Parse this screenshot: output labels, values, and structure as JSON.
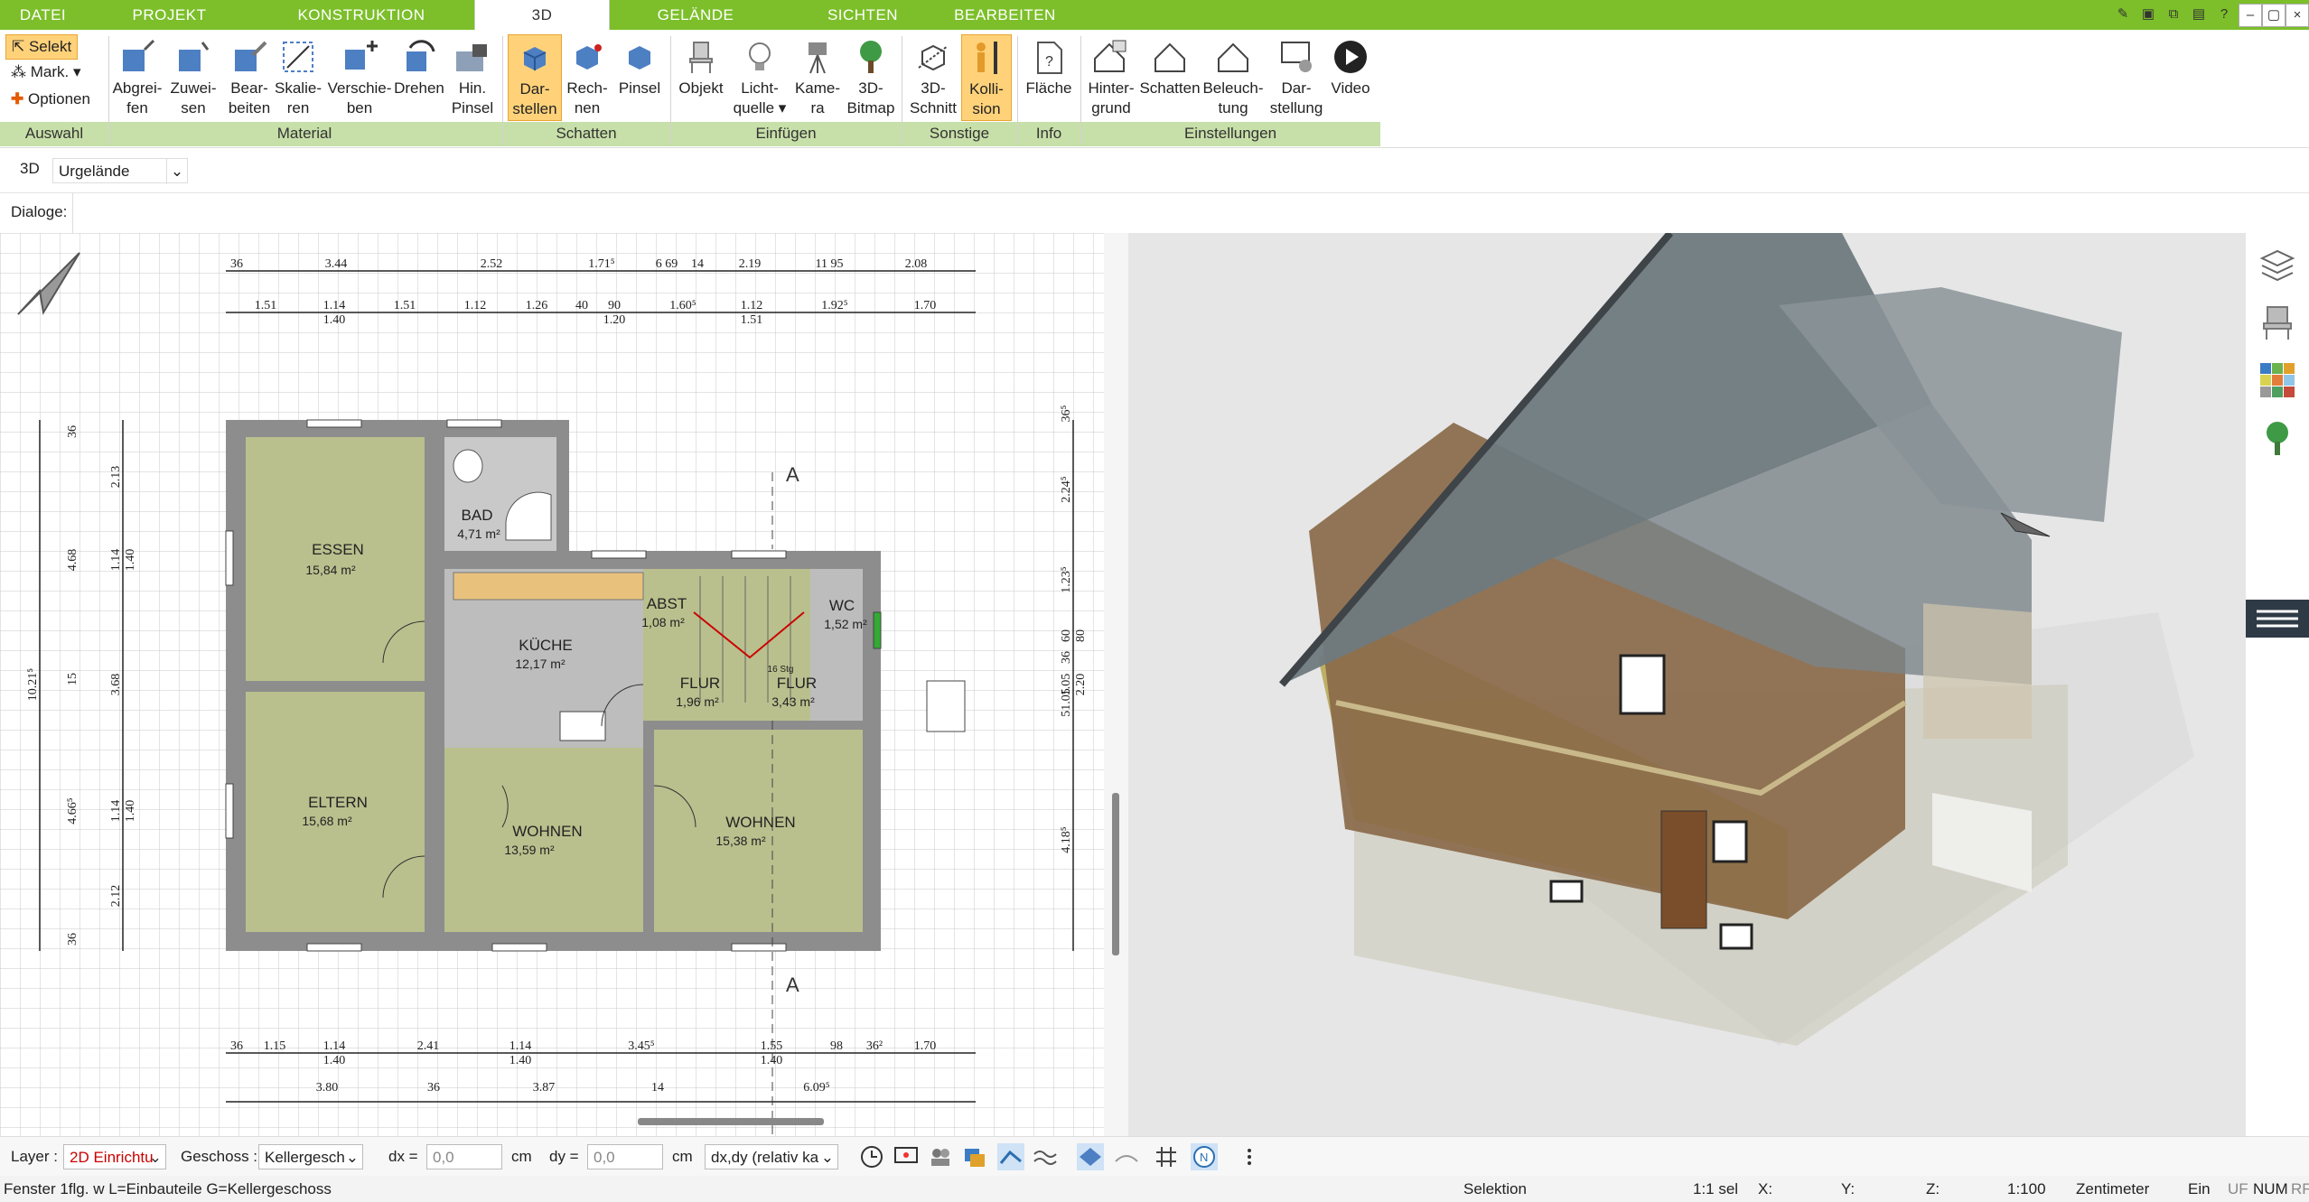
{
  "menu": {
    "tabs": [
      "DATEI",
      "PROJEKT",
      "KONSTRUKTION",
      "3D",
      "GELÄNDE",
      "SICHTEN",
      "BEARBEITEN"
    ],
    "active_tab": "3D"
  },
  "ribbon": {
    "auswahl": {
      "selekt": "Selekt",
      "mark": "Mark.",
      "optionen": "Optionen",
      "label": "Auswahl"
    },
    "material": {
      "label": "Material",
      "buttons": [
        [
          "Abgrei-",
          "fen"
        ],
        [
          "Zuwei-",
          "sen"
        ],
        [
          "Bear-",
          "beiten"
        ],
        [
          "Skalie-",
          "ren"
        ],
        [
          "Verschie-",
          "ben"
        ],
        [
          "Drehen",
          ""
        ],
        [
          "Hin.",
          "Pinsel"
        ]
      ]
    },
    "schatten": {
      "label": "Schatten",
      "buttons": [
        [
          "Dar-",
          "stellen"
        ],
        [
          "Rech-",
          "nen"
        ],
        [
          "Pinsel",
          ""
        ]
      ]
    },
    "einfuegen": {
      "label": "Einfügen",
      "buttons": [
        [
          "Objekt",
          ""
        ],
        [
          "Licht-",
          "quelle"
        ],
        [
          "Kame-",
          "ra"
        ],
        [
          "3D-",
          "Bitmap"
        ]
      ]
    },
    "sonstige": {
      "label": "Sonstige",
      "buttons": [
        [
          "3D-",
          "Schnitt"
        ],
        [
          "Kolli-",
          "sion"
        ]
      ]
    },
    "info": {
      "label": "Info",
      "buttons": [
        [
          "Fläche",
          ""
        ]
      ]
    },
    "einstellungen": {
      "label": "Einstellungen",
      "buttons": [
        [
          "Hinter-",
          "grund"
        ],
        [
          "Schatten",
          ""
        ],
        [
          "Beleuch-",
          "tung"
        ],
        [
          "Dar-",
          "stellung"
        ],
        [
          "Video",
          ""
        ]
      ]
    }
  },
  "toolbar2": {
    "mode": "3D",
    "select_value": "Urgelände"
  },
  "dialogs": {
    "label": "Dialoge:"
  },
  "plan": {
    "rooms": [
      {
        "name": "ESSEN",
        "area": "15,84 m²"
      },
      {
        "name": "BAD",
        "area": "4,71 m²"
      },
      {
        "name": "KÜCHE",
        "area": "12,17 m²"
      },
      {
        "name": "ABST",
        "area": "1,08 m²"
      },
      {
        "name": "WC",
        "area": "1,52 m²"
      },
      {
        "name": "FLUR",
        "area": "1,96 m²"
      },
      {
        "name": "FLUR",
        "area": "3,43 m²"
      },
      {
        "name": "ELTERN",
        "area": "15,68 m²"
      },
      {
        "name": "WOHNEN",
        "area": "13,59 m²"
      },
      {
        "name": "WOHNEN",
        "area": "15,38 m²"
      }
    ],
    "section_mark": "A",
    "dims_top1": [
      "36",
      "3.44",
      "2.52",
      "1.71⁵",
      "6 69",
      "14",
      "2.19",
      "11 95",
      "2.08"
    ],
    "dims_top2": [
      "1.51",
      "1.14",
      "1.40",
      "1.51",
      "1.12",
      "1.26",
      "40",
      "90",
      "1.20",
      "1.60⁵",
      "1.12",
      "1.51",
      "1.92⁵",
      "1.70"
    ],
    "dims_bottom1": [
      "36",
      "1.15",
      "1.14",
      "1.40",
      "2.41",
      "1.14",
      "1.40",
      "3.45⁵",
      "1.55",
      "1.40",
      "98",
      "36²",
      "1.70"
    ],
    "dims_bottom2": [
      "3.80",
      "36",
      "3.87",
      "14",
      "6.09⁵"
    ],
    "dims_left": [
      "36",
      "2.13",
      "4.68",
      "1.14",
      "1.40",
      "10.21⁵",
      "15",
      "3.68",
      "4.66⁵",
      "1.14",
      "1.40",
      "2.12",
      "36"
    ],
    "dims_right": [
      "36⁵",
      "2.24⁵",
      "1.23⁵",
      "60",
      "80",
      "51.05",
      "1.05",
      "36",
      "2.20",
      "4.18⁵"
    ],
    "stairs_label": "16 Stg"
  },
  "statusbar": {
    "layer_label": "Layer :",
    "layer_value": "2D Einrichtu",
    "geschoss_label": "Geschoss :",
    "geschoss_value": "Kellergesch",
    "dx_label": "dx =",
    "dx_value": "0,0",
    "dx_unit": "cm",
    "dy_label": "dy =",
    "dy_value": "0,0",
    "dy_unit": "cm",
    "mode_value": "dx,dy (relativ ka"
  },
  "infobar": {
    "text": "Fenster 1flg. w L=Einbauteile G=Kellergeschoss",
    "selektion": "Selektion",
    "sel": "1:1 sel",
    "x": "X:",
    "y": "Y:",
    "z": "Z:",
    "scale": "1:100",
    "unit": "Zentimeter",
    "ein": "Ein",
    "uf": "UF",
    "num": "NUM",
    "rf": "RF"
  },
  "colors": {
    "accent": "#7cbf2a",
    "group_bar": "#c7dfa8",
    "room_fill": "#b9c08d",
    "wall": "#8d8d8d",
    "roof": "#7b8489",
    "wood": "#8a6a4a"
  }
}
